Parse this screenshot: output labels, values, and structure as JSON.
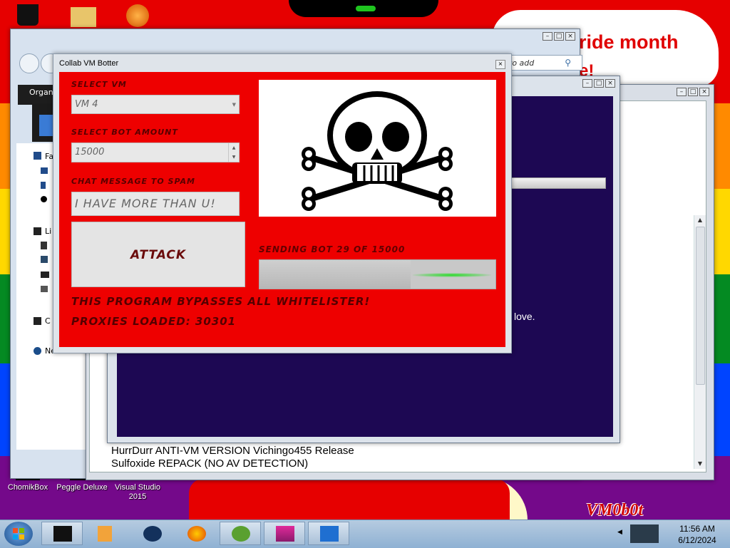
{
  "desktop": {
    "banner": "ride month",
    "banner_line2": "e!",
    "signature": "VM0b0t",
    "icons": [
      {
        "label": "ChomikBox"
      },
      {
        "label": "Peggle Deluxe"
      },
      {
        "label": "Visual Studio 2015"
      }
    ],
    "left_edge": {
      "organize": "Organ",
      "favorites": "Fa",
      "libraries": "Li",
      "computer": "C",
      "network": "Network"
    }
  },
  "explorer": {
    "search_placeholder": "to add"
  },
  "text_window": {
    "line_love": "love.",
    "bottom_line1": "HurrDurr ANTI-VM VERSION Vichingo455 Release",
    "bottom_line2": "Sulfoxide REPACK (NO AV DETECTION)"
  },
  "botter": {
    "title": "Collab VM Botter",
    "select_vm_label": "SELECT VM",
    "select_vm_value": "VM 4",
    "bot_amount_label": "SELECT BOT AMOUNT",
    "bot_amount_value": "15000",
    "chat_label": "CHAT MESSAGE TO SPAM",
    "chat_value": "I HAVE MORE THAN U!",
    "attack_label": "ATTACK",
    "status": "SENDING BOT 29 OF 15000",
    "progress_fraction": 0.64,
    "note1": "THIS PROGRAM BYPASSES ALL WHITELISTER!",
    "note2": "PROXIES LOADED: 30301",
    "accent_color": "#ee0000"
  },
  "taskbar": {
    "time": "11:56 AM",
    "date": "6/12/2024"
  }
}
